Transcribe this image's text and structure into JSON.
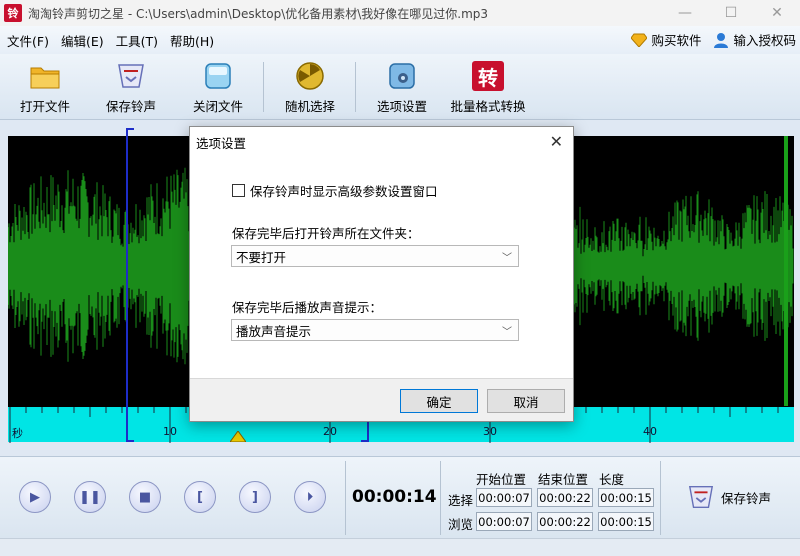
{
  "window": {
    "title": "淘淘铃声剪切之星 - C:\\Users\\admin\\Desktop\\优化备用素材\\我好像在哪见过你.mp3",
    "app_icon_glyph": "铃"
  },
  "menu": {
    "items": [
      "文件(F)",
      "编辑(E)",
      "工具(T)",
      "帮助(H)"
    ],
    "buy_label": "购买软件",
    "license_label": "输入授权码"
  },
  "toolbar": {
    "open_label": "打开文件",
    "save_label": "保存铃声",
    "close_label": "关闭文件",
    "random_label": "随机选择",
    "options_label": "选项设置",
    "batch_label": "批量格式转换",
    "batch_glyph": "转"
  },
  "ruler": {
    "unit": "秒",
    "labels": [
      "10",
      "20",
      "30",
      "40"
    ]
  },
  "dialog": {
    "title": "选项设置",
    "checkbox_label": "保存铃声时显示高级参数设置窗口",
    "checkbox_checked": false,
    "folder_label": "保存完毕后打开铃声所在文件夹：",
    "folder_value": "不要打开",
    "sound_label": "保存完毕后播放声音提示：",
    "sound_value": "播放声音提示",
    "ok_label": "确定",
    "cancel_label": "取消"
  },
  "bottom": {
    "time": "00:00:14",
    "headers": {
      "start": "开始位置",
      "end": "结束位置",
      "length": "长度"
    },
    "select_label": "选择",
    "preview_label": "浏览",
    "select": {
      "start": "00:00:07",
      "end": "00:00:22",
      "length": "00:00:15"
    },
    "preview": {
      "start": "00:00:07",
      "end": "00:00:22",
      "length": "00:00:15"
    },
    "save_label": "保存铃声"
  },
  "colors": {
    "waveform": "#1a8c1a",
    "ruler": "#00e5e5",
    "selection": "#1e2dc8",
    "dialog_bg": "#f0f0f0"
  }
}
